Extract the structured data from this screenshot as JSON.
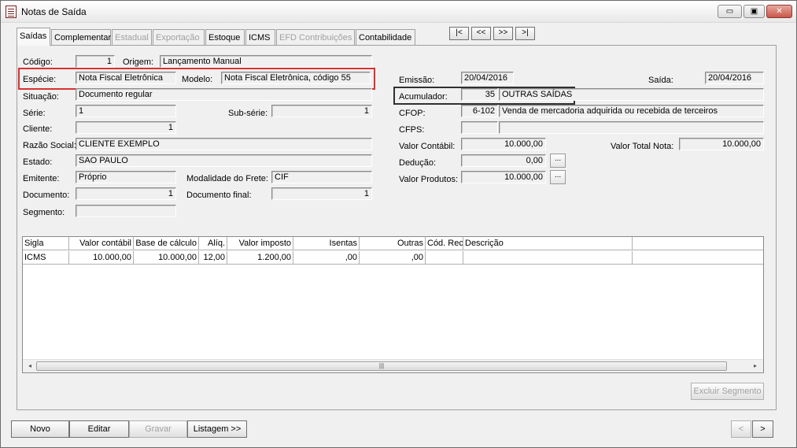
{
  "window": {
    "title": "Notas de Saída",
    "minimize": "▭",
    "maximize": "▣",
    "close": "✕"
  },
  "tabs": [
    "Saídas",
    "Complementar",
    "Estadual",
    "Exportação",
    "Estoque",
    "ICMS",
    "EFD Contribuições",
    "Contabilidade"
  ],
  "nav": {
    "first": "|<",
    "prev": "<<",
    "next": ">>",
    "last": ">|"
  },
  "form": {
    "codigo": {
      "label": "Código:",
      "value": "1"
    },
    "origem": {
      "label": "Origem:",
      "value": "Lançamento Manual"
    },
    "especie": {
      "label": "Espécie:",
      "value": "Nota Fiscal Eletrônica"
    },
    "modelo": {
      "label": "Modelo:",
      "value": "Nota Fiscal Eletrônica, código 55"
    },
    "situacao": {
      "label": "Situação:",
      "value": "Documento regular"
    },
    "serie": {
      "label": "Série:",
      "value": "1"
    },
    "subserie": {
      "label": "Sub-série:",
      "value": "1"
    },
    "cliente": {
      "label": "Cliente:",
      "value": "1"
    },
    "razao_social": {
      "label": "Razão Social:",
      "value": "CLIENTE EXEMPLO"
    },
    "estado": {
      "label": "Estado:",
      "value": "SAO PAULO"
    },
    "emitente": {
      "label": "Emitente:",
      "value": "Próprio"
    },
    "modalidade": {
      "label": "Modalidade do Frete:",
      "value": "CIF"
    },
    "documento": {
      "label": "Documento:",
      "value": "1"
    },
    "documento_final": {
      "label": "Documento final:",
      "value": "1"
    },
    "segmento": {
      "label": "Segmento:",
      "value": ""
    },
    "emissao": {
      "label": "Emissão:",
      "value": "20/04/2016"
    },
    "saida": {
      "label": "Saída:",
      "value": "20/04/2016"
    },
    "acumulador": {
      "label": "Acumulador:",
      "code": "35",
      "desc": "OUTRAS SAÍDAS"
    },
    "cfop": {
      "label": "CFOP:",
      "code": "6-102",
      "desc": "Venda de mercadoria adquirida ou recebida de terceiros"
    },
    "cfps": {
      "label": "CFPS:",
      "code": "",
      "desc": ""
    },
    "valor_contabil": {
      "label": "Valor Contábil:",
      "value": "10.000,00"
    },
    "valor_total_nota": {
      "label": "Valor Total Nota:",
      "value": "10.000,00"
    },
    "deducao": {
      "label": "Dedução:",
      "value": "0,00"
    },
    "valor_produtos": {
      "label": "Valor Produtos:",
      "value": "10.000,00"
    },
    "ellipsis": "..."
  },
  "grid": {
    "columns": [
      "Sigla",
      "Valor contábil",
      "Base de cálculo",
      "Alíq.",
      "Valor imposto",
      "Isentas",
      "Outras",
      "Cód. Rec.",
      "Descrição"
    ],
    "rows": [
      [
        "ICMS",
        "10.000,00",
        "10.000,00",
        "12,00",
        "1.200,00",
        ",00",
        ",00",
        "",
        ""
      ]
    ],
    "scroll_left": "◂",
    "scroll_right": "▸",
    "thumb_grip": "|||"
  },
  "buttons": {
    "excluir_segmento": "Excluir Segmento",
    "novo": "Novo",
    "editar": "Editar",
    "gravar": "Gravar",
    "listagem": "Listagem >>",
    "prev": "<",
    "next": ">"
  }
}
